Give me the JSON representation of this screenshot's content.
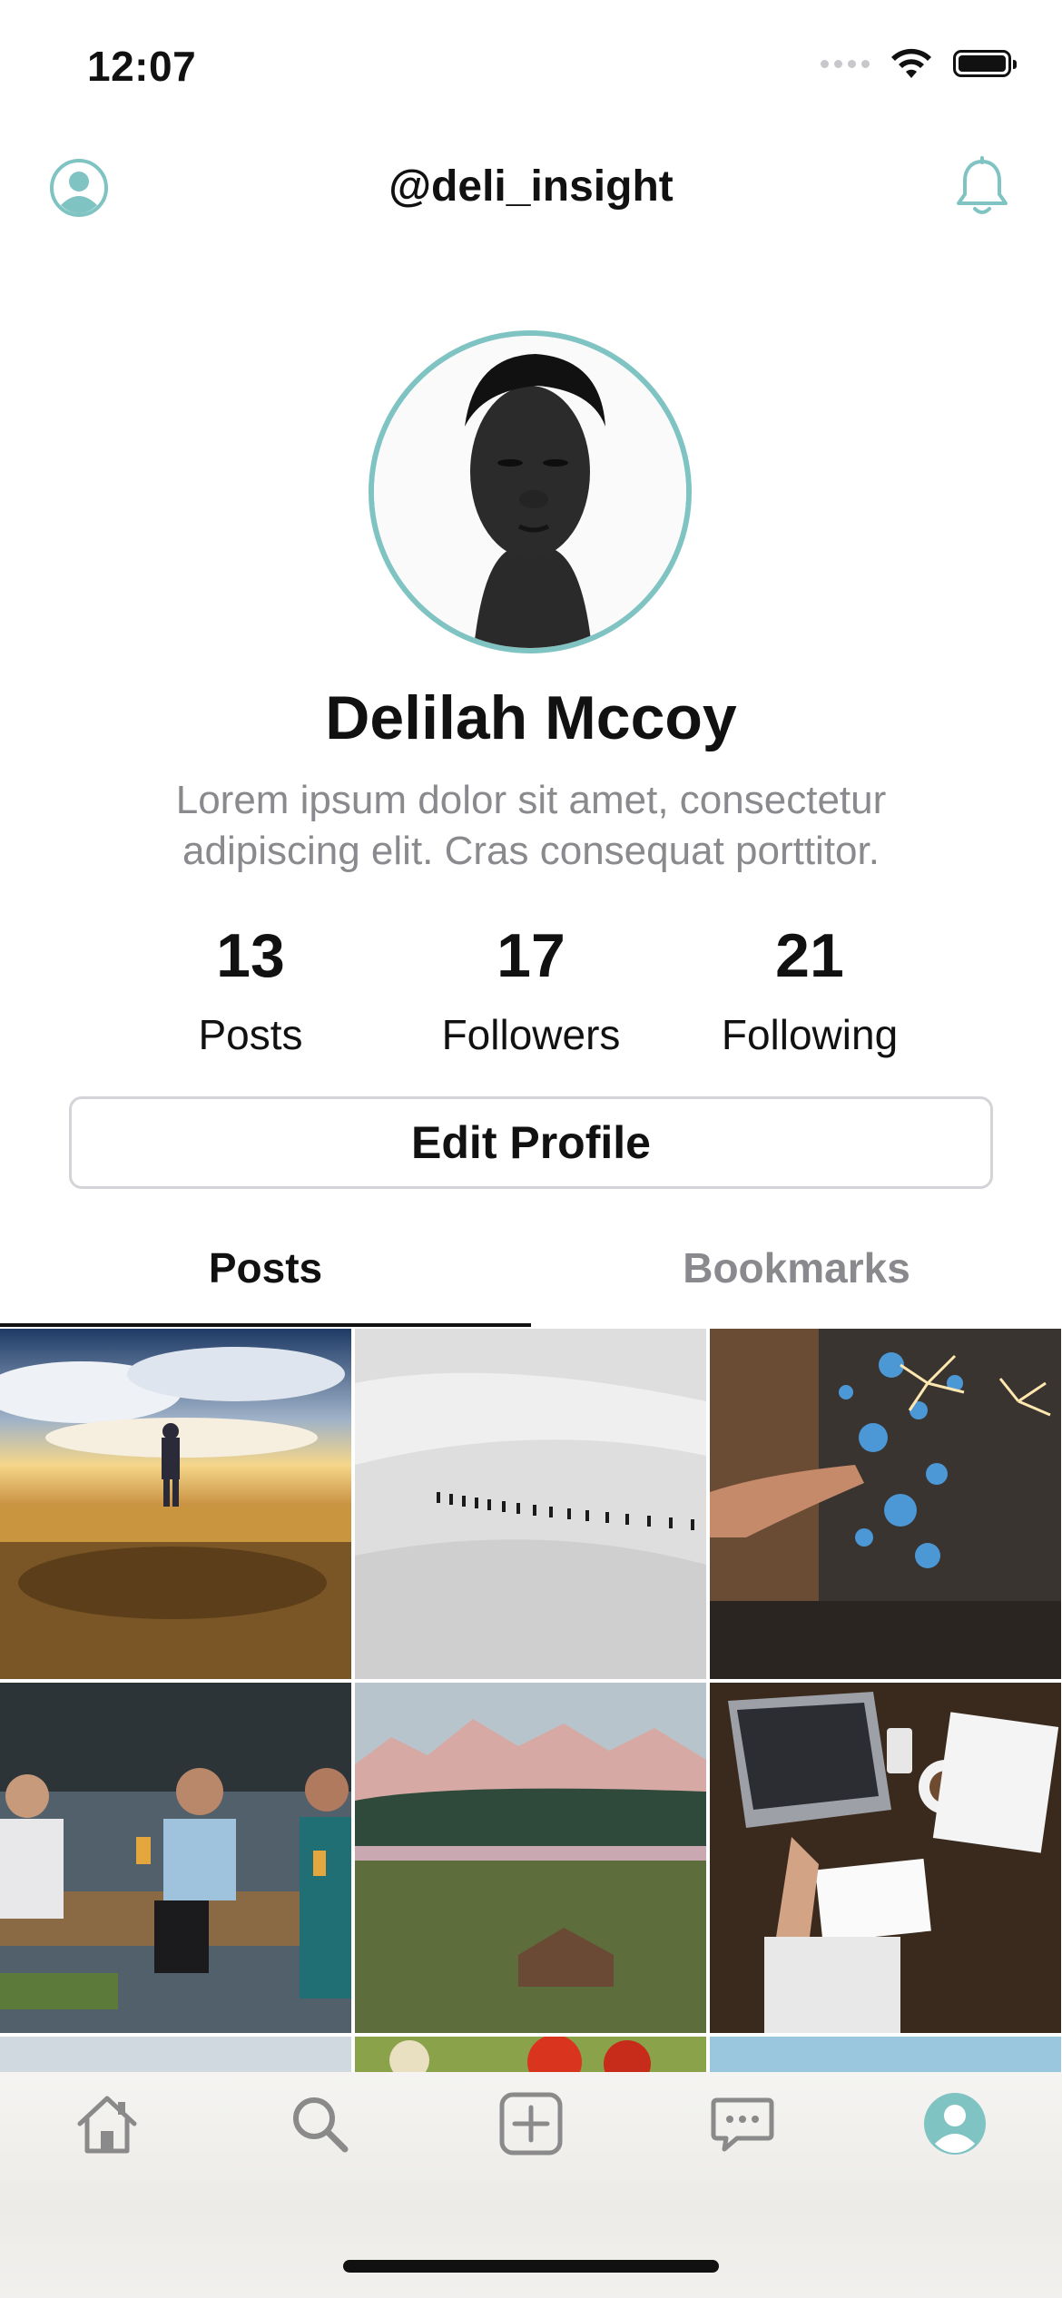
{
  "status": {
    "time": "12:07"
  },
  "header": {
    "title": "@deli_insight"
  },
  "profile": {
    "name": "Delilah Mccoy",
    "bio": "Lorem ipsum dolor sit amet, consectetur adipiscing elit. Cras consequat porttitor.",
    "stats": [
      {
        "value": "13",
        "label": "Posts"
      },
      {
        "value": "17",
        "label": "Followers"
      },
      {
        "value": "21",
        "label": "Following"
      }
    ],
    "edit_label": "Edit Profile"
  },
  "tabs": {
    "posts": "Posts",
    "bookmarks": "Bookmarks",
    "active": "Posts"
  },
  "grid": {
    "photos": [
      "beach-sunset-person",
      "snow-hikers-line",
      "sparklers-bokeh",
      "friends-drinking-bar",
      "mountain-lake-cabin",
      "laptop-coffee-desk"
    ]
  },
  "tabbar": {
    "items": [
      {
        "icon": "home-icon"
      },
      {
        "icon": "search-icon"
      },
      {
        "icon": "add-post-icon"
      },
      {
        "icon": "chat-icon"
      },
      {
        "icon": "profile-icon",
        "active": true
      }
    ],
    "accent": "#7fc3c3",
    "inactive": "#8a8a8a"
  },
  "colors": {
    "accent": "#7fc3c3",
    "muted_text": "#8a8a8e"
  }
}
